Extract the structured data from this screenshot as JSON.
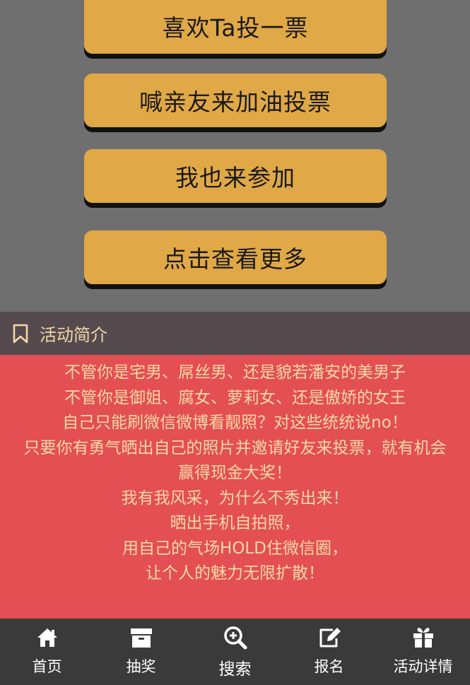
{
  "actions": {
    "like_vote": "喜欢Ta投一票",
    "invite_friends": "喊亲友来加油投票",
    "join": "我也来参加",
    "view_more": "点击查看更多"
  },
  "intro": {
    "title": "活动简介",
    "lines": [
      "不管你是宅男、屌丝男、还是貌若潘安的美男子",
      "不管你是御姐、腐女、萝莉女、还是傲娇的女王",
      "自己只能刷微信微博看靓照？对这些统统说no！",
      "只要你有勇气晒出自己的照片并邀请好友来投票，就有机会",
      "赢得现金大奖！",
      "我有我风采，为什么不秀出来！",
      "晒出手机自拍照，",
      "用自己的气场HOLD住微信圈，",
      "让个人的魅力无限扩散！"
    ]
  },
  "nav": {
    "home": "首页",
    "lottery": "抽奖",
    "search": "搜索",
    "signup": "报名",
    "details": "活动详情"
  },
  "colors": {
    "button_bg": "#e0a846",
    "intro_bg": "#e34f53",
    "intro_text": "#f7d9a6",
    "header_bg": "#554a4e",
    "nav_bg": "#3a3a3a"
  }
}
